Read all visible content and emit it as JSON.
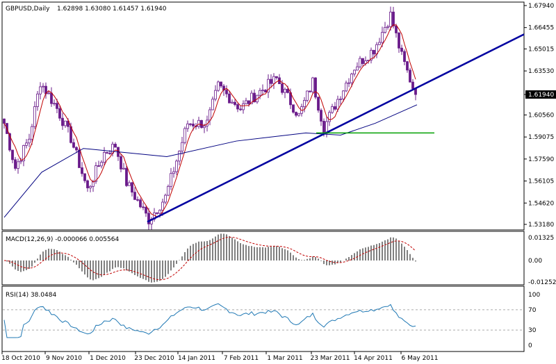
{
  "chart_data": [
    {
      "type": "candlestick",
      "title": "GBPUSD,Daily",
      "ohlc_label": "1.62898 1.63080 1.61457 1.61940",
      "y_ticks": [
        "1.67940",
        "1.66455",
        "1.65015",
        "1.63530",
        "1.61940",
        "1.60560",
        "1.59075",
        "1.57590",
        "1.56105",
        "1.54620",
        "1.53180"
      ],
      "ylim": [
        1.5318,
        1.6794
      ],
      "current_price": "1.61940",
      "close_keypoints": [
        [
          0,
          1.6
        ],
        [
          4,
          1.57
        ],
        [
          9,
          1.59
        ],
        [
          13,
          1.628
        ],
        [
          19,
          1.61
        ],
        [
          24,
          1.59
        ],
        [
          30,
          1.555
        ],
        [
          36,
          1.58
        ],
        [
          40,
          1.585
        ],
        [
          44,
          1.56
        ],
        [
          52,
          1.535
        ],
        [
          58,
          1.55
        ],
        [
          66,
          1.6
        ],
        [
          73,
          1.6
        ],
        [
          77,
          1.625
        ],
        [
          85,
          1.61
        ],
        [
          91,
          1.62
        ],
        [
          98,
          1.63
        ],
        [
          106,
          1.605
        ],
        [
          111,
          1.628
        ],
        [
          115,
          1.597
        ],
        [
          121,
          1.62
        ],
        [
          126,
          1.638
        ],
        [
          133,
          1.65
        ],
        [
          139,
          1.673
        ],
        [
          143,
          1.645
        ],
        [
          148,
          1.6194
        ]
      ],
      "trendline": {
        "from": 1.5335,
        "to": 1.66,
        "color": "#0000a0"
      },
      "support_level": {
        "value": 1.5935,
        "color": "#00a000"
      },
      "x_ticks": [
        "18 Oct 2010",
        "9 Nov 2010",
        "1 Dec 2010",
        "23 Dec 2010",
        "14 Jan 2011",
        "7 Feb 2011",
        "1 Mar 2011",
        "23 Mar 2011",
        "14 Apr 2011",
        "6 May 2011"
      ],
      "colors": {
        "candle": "#6a1b8a",
        "ma_fast": "#c00000",
        "ma_slow": "#000080"
      }
    },
    {
      "type": "bar",
      "title": "MACD(12,26,9) -0.000066 0.005564",
      "y_ticks": [
        "0.01325",
        "0.00",
        "-0.01252"
      ],
      "ylim": [
        -0.01252,
        0.01325
      ]
    },
    {
      "type": "line",
      "title": "RSI(14) 38.0484",
      "y_ticks": [
        "100",
        "70",
        "30",
        "0"
      ],
      "ylim": [
        0,
        100
      ],
      "last_value": 38.0484,
      "color": "#1f78b4"
    }
  ]
}
